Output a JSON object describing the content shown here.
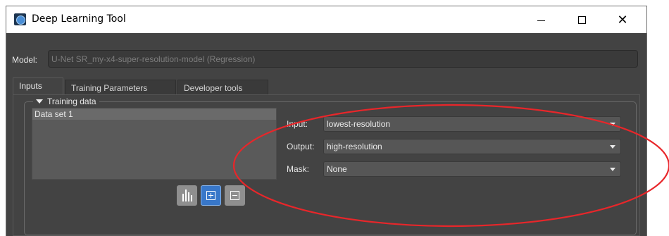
{
  "window": {
    "title": "Deep Learning Tool",
    "icon": "app-icon"
  },
  "model": {
    "label": "Model:",
    "value": "U-Net SR_my-x4-super-resolution-model (Regression)"
  },
  "tabs": [
    {
      "label": "Inputs",
      "active": true
    },
    {
      "label": "Training Parameters",
      "active": false
    },
    {
      "label": "Developer tools",
      "active": false
    }
  ],
  "training_data": {
    "title": "Training data",
    "datasets": [
      "Data set 1"
    ],
    "buttons": {
      "stats_icon": "bar-chart-icon",
      "add_icon": "plus-box-icon",
      "remove_icon": "minus-box-icon"
    },
    "fields": [
      {
        "label": "Input:",
        "value": "lowest-resolution"
      },
      {
        "label": "Output:",
        "value": "high-resolution"
      },
      {
        "label": "Mask:",
        "value": "None"
      }
    ]
  },
  "colors": {
    "background": "#434343",
    "accent": "#3877c9",
    "annotation": "#e8262a"
  }
}
